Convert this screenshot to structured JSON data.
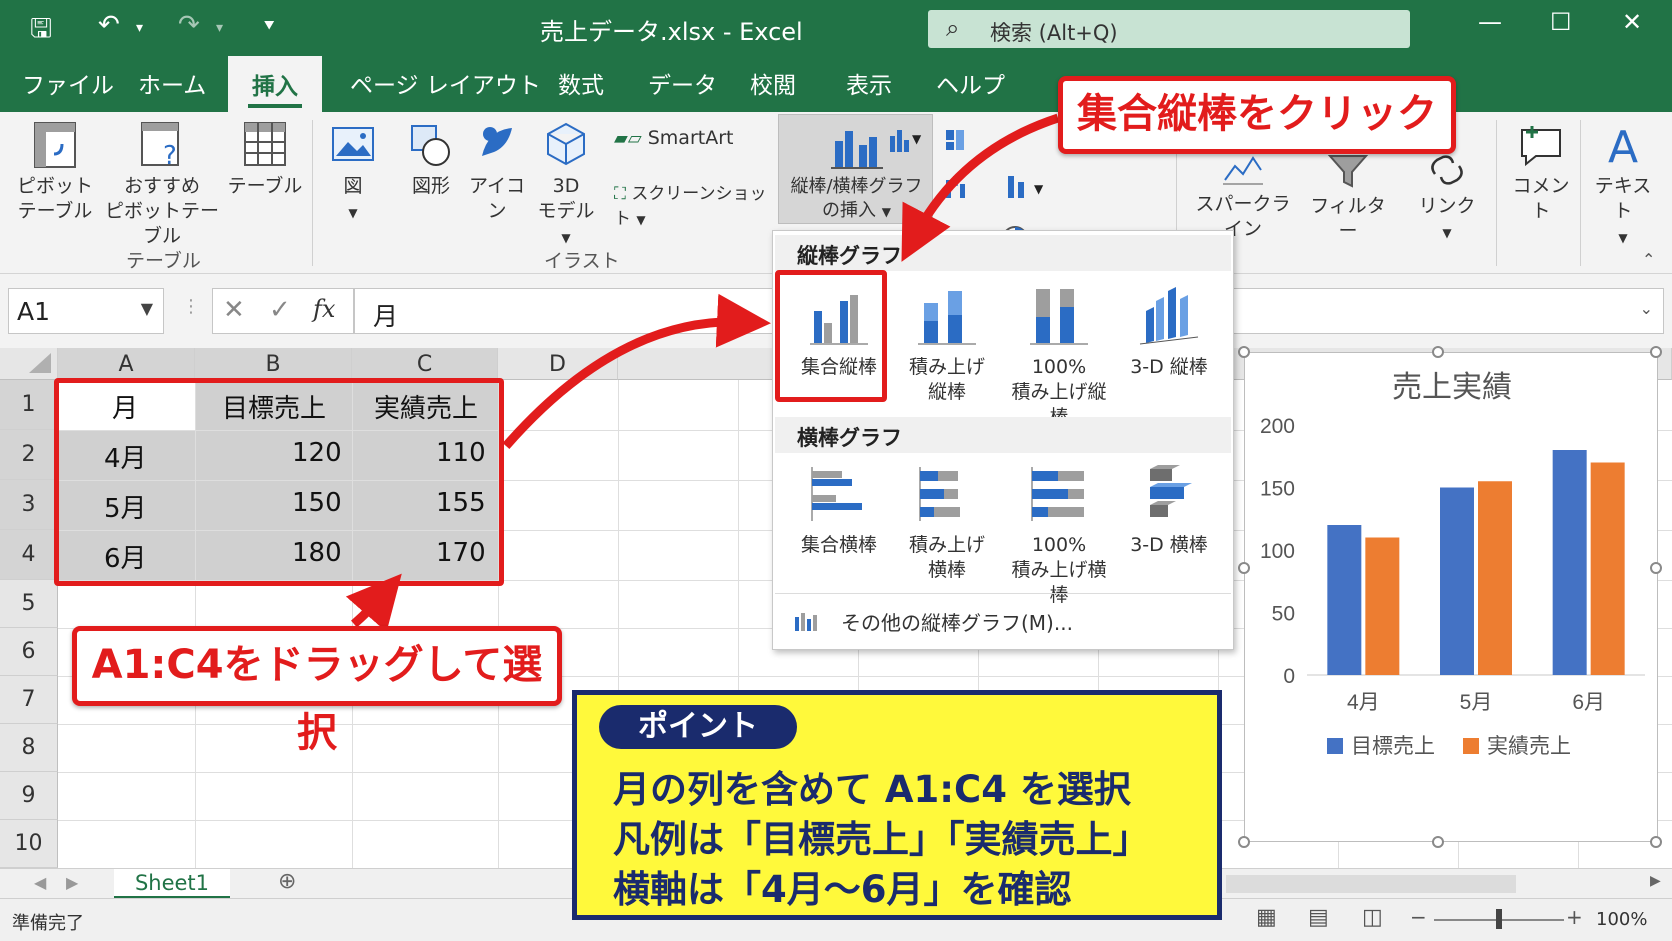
{
  "window": {
    "title": "売上データ.xlsx - Excel",
    "search_placeholder": "検索 (Alt+Q)"
  },
  "tabs": [
    "ファイル",
    "ホーム",
    "挿入",
    "ページ レイアウト",
    "数式",
    "データ",
    "校閲",
    "表示",
    "ヘルプ"
  ],
  "ribbon": {
    "pivot_label_1": "ピボット",
    "pivot_label_2": "テーブル",
    "rec_pivot_1": "おすすめ",
    "rec_pivot_2": "ピボットテーブル",
    "table_label": "テーブル",
    "group_table": "テーブル",
    "figure_label": "図",
    "shape_label": "図形",
    "icon_label": "アイコン",
    "model_label_1": "3D",
    "model_label_2": "モデル",
    "smartart_label": "SmartArt",
    "screenshot_label": "スクリーンショット",
    "group_illust": "イラスト",
    "chart_insert_1": "縦棒/横棒グラフ",
    "chart_insert_2": "の挿入",
    "sparkline_label": "スパークライン",
    "filter_label": "フィルター",
    "link_label": "リンク",
    "comment_label": "コメント",
    "text_label": "テキスト"
  },
  "formula_bar": {
    "name_box": "A1",
    "fx": "fx",
    "content": "月"
  },
  "grid": {
    "columns": [
      "A",
      "B",
      "C",
      "D"
    ],
    "rows": [
      "1",
      "2",
      "3",
      "4",
      "5",
      "6",
      "7",
      "8",
      "9",
      "10"
    ],
    "cells": [
      [
        "月",
        "目標売上",
        "実績売上"
      ],
      [
        "4月",
        "120",
        "110"
      ],
      [
        "5月",
        "150",
        "155"
      ],
      [
        "6月",
        "180",
        "170"
      ]
    ]
  },
  "sheet_tab": "Sheet1",
  "status": {
    "ready": "準備完了",
    "zoom": "100%"
  },
  "dropdown": {
    "vertical_header": "縦棒グラフ",
    "vertical_items": [
      {
        "l1": "集合縦棒",
        "l2": ""
      },
      {
        "l1": "積み上げ",
        "l2": "縦棒"
      },
      {
        "l1": "100%",
        "l2": "積み上げ縦棒"
      },
      {
        "l1": "3-D 縦棒",
        "l2": ""
      }
    ],
    "horizontal_header": "横棒グラフ",
    "horizontal_items": [
      {
        "l1": "集合横棒",
        "l2": ""
      },
      {
        "l1": "積み上げ",
        "l2": "横棒"
      },
      {
        "l1": "100%",
        "l2": "積み上げ横棒"
      },
      {
        "l1": "3-D 横棒",
        "l2": ""
      }
    ],
    "more": "その他の縦棒グラフ(M)..."
  },
  "callouts": {
    "click_hint": "集合縦棒をクリック",
    "drag_hint": "A1:C4をドラッグして選択",
    "point_title": "ポイント",
    "point_lines": [
      "月の列を含めて A1:C4 を選択",
      "凡例は「目標売上」「実績売上」",
      "横軸は「4月〜6月」を確認"
    ]
  },
  "colors": {
    "excel_green": "#217346",
    "series_1": "#4472c4",
    "series_2": "#ed7d31",
    "callout_red": "#e21c1c",
    "point_yellow": "#fff93b",
    "point_navy": "#1a2b6d"
  },
  "chart_data": {
    "type": "bar",
    "title": "売上実績",
    "categories": [
      "4月",
      "5月",
      "6月"
    ],
    "series": [
      {
        "name": "目標売上",
        "values": [
          120,
          150,
          180
        ]
      },
      {
        "name": "実績売上",
        "values": [
          110,
          155,
          170
        ]
      }
    ],
    "ylim": [
      0,
      200
    ],
    "yticks": [
      0,
      50,
      100,
      150,
      200
    ],
    "legend": "bottom",
    "grid": false
  }
}
